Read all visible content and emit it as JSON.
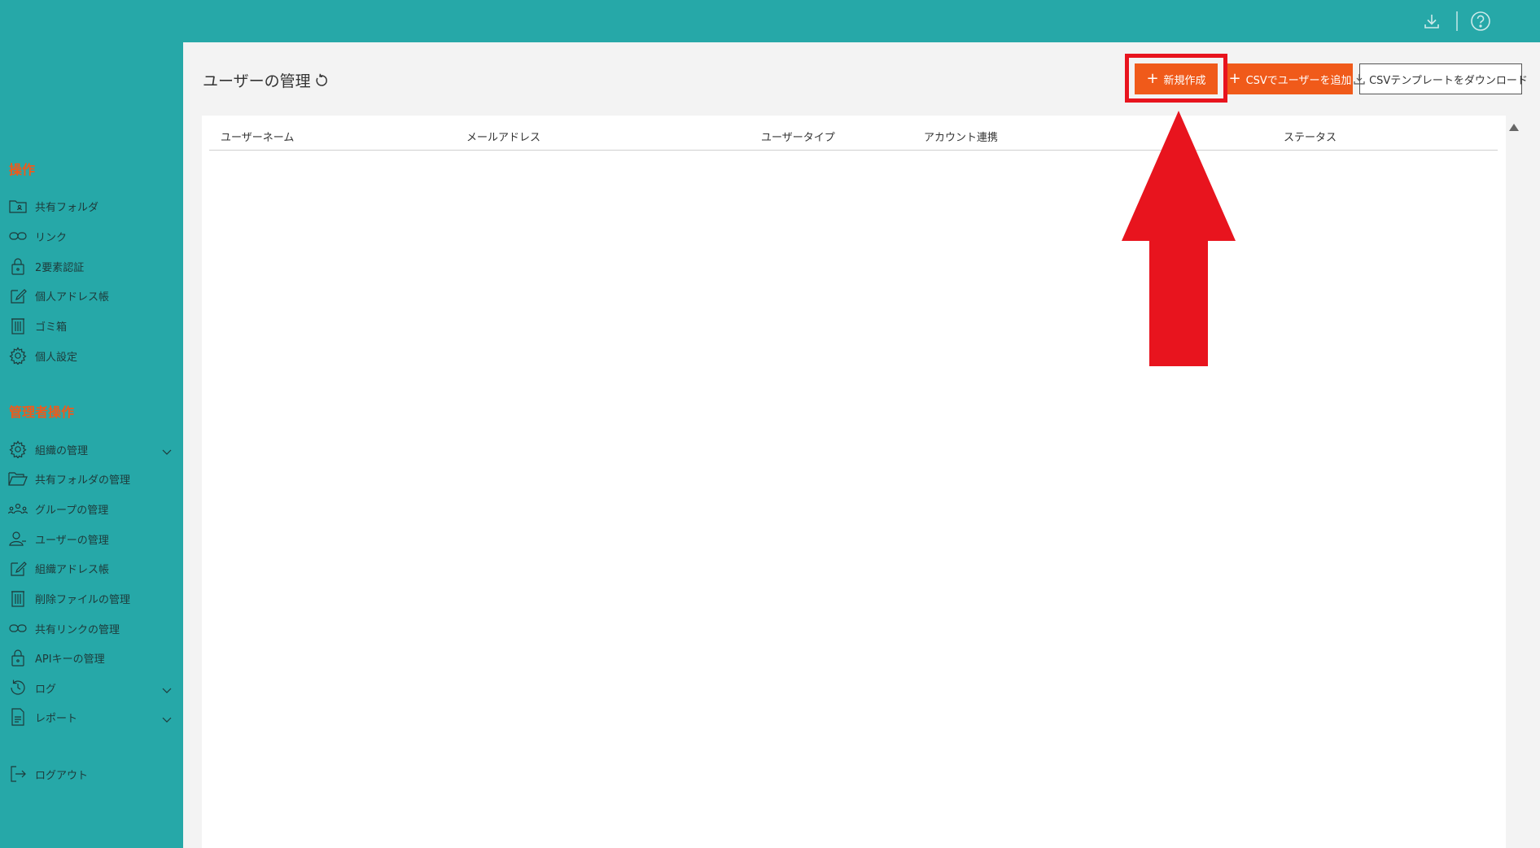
{
  "topbar": {
    "download_icon": "download-icon",
    "help_icon": "help-circle-icon"
  },
  "sidebar": {
    "section_operations": "操作",
    "operations": [
      {
        "label": "共有フォルダ",
        "icon": "shared-folder-icon"
      },
      {
        "label": "リンク",
        "icon": "link-icon"
      },
      {
        "label": "2要素認証",
        "icon": "lock-icon"
      },
      {
        "label": "個人アドレス帳",
        "icon": "edit-icon"
      },
      {
        "label": "ゴミ箱",
        "icon": "trash-icon"
      },
      {
        "label": "個人設定",
        "icon": "gear-icon"
      }
    ],
    "section_admin": "管理者操作",
    "admin": [
      {
        "label": "組織の管理",
        "icon": "gear-icon",
        "expandable": true
      },
      {
        "label": "共有フォルダの管理",
        "icon": "folder-open-icon"
      },
      {
        "label": "グループの管理",
        "icon": "group-icon"
      },
      {
        "label": "ユーザーの管理",
        "icon": "user-icon"
      },
      {
        "label": "組織アドレス帳",
        "icon": "edit-icon"
      },
      {
        "label": "削除ファイルの管理",
        "icon": "trash-icon"
      },
      {
        "label": "共有リンクの管理",
        "icon": "link-icon"
      },
      {
        "label": "APIキーの管理",
        "icon": "lock-icon"
      },
      {
        "label": "ログ",
        "icon": "history-icon",
        "expandable": true
      },
      {
        "label": "レポート",
        "icon": "document-icon",
        "expandable": true
      }
    ],
    "logout": {
      "label": "ログアウト",
      "icon": "logout-icon"
    }
  },
  "main": {
    "title": "ユーザーの管理",
    "buttons": {
      "new": "新規作成",
      "csv_add": "CSVでユーザーを追加",
      "csv_template": "CSVテンプレートをダウンロード"
    },
    "table": {
      "columns": [
        "ユーザーネーム",
        "メールアドレス",
        "ユーザータイプ",
        "アカウント連携",
        "ステータス"
      ]
    }
  },
  "colors": {
    "teal": "#26a8a8",
    "orange": "#f05a1a",
    "annotation_red": "#e8141e"
  }
}
